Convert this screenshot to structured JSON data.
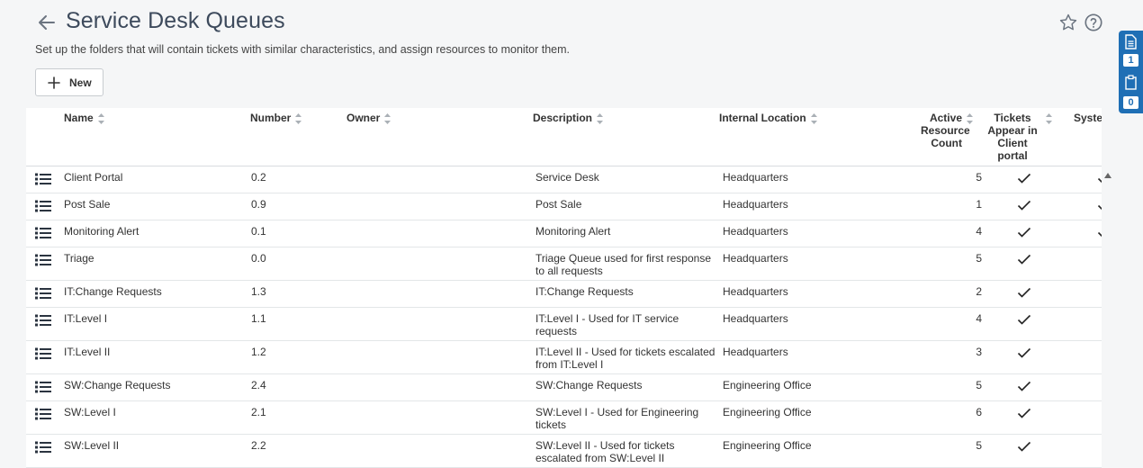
{
  "header": {
    "title": "Service Desk Queues",
    "subtitle": "Set up the folders that will contain tickets with similar characteristics, and assign resources to monitor them."
  },
  "toolbar": {
    "new_label": "New"
  },
  "side_panel": {
    "badge_top": "1",
    "badge_bottom": "0"
  },
  "table": {
    "columns": {
      "name": "Name",
      "number": "Number",
      "owner": "Owner",
      "description": "Description",
      "location": "Internal Location",
      "active_count": "Active Resource Count",
      "portal": "Tickets Appear in Client portal",
      "system": "System"
    },
    "rows": [
      {
        "name": "Client Portal",
        "number": "0.2",
        "owner": "",
        "desc1": "Service Desk",
        "desc2": "",
        "location": "Headquarters",
        "count": "5",
        "portal": true,
        "system": true
      },
      {
        "name": "Post Sale",
        "number": "0.9",
        "owner": "",
        "desc1": "Post Sale",
        "desc2": "",
        "location": "Headquarters",
        "count": "1",
        "portal": true,
        "system": true
      },
      {
        "name": "Monitoring Alert",
        "number": "0.1",
        "owner": "",
        "desc1": "Monitoring Alert",
        "desc2": "",
        "location": "Headquarters",
        "count": "4",
        "portal": true,
        "system": true
      },
      {
        "name": "Triage",
        "number": "0.0",
        "owner": "",
        "desc1": "Triage Queue used for first response",
        "desc2": "to all requests",
        "location": "Headquarters",
        "count": "5",
        "portal": true,
        "system": false
      },
      {
        "name": "IT:Change Requests",
        "number": "1.3",
        "owner": "",
        "desc1": "IT:Change Requests",
        "desc2": "",
        "location": "Headquarters",
        "count": "2",
        "portal": true,
        "system": false
      },
      {
        "name": "IT:Level I",
        "number": "1.1",
        "owner": "",
        "desc1": "IT:Level I - Used for IT service",
        "desc2": "requests",
        "location": "Headquarters",
        "count": "4",
        "portal": true,
        "system": false
      },
      {
        "name": "IT:Level II",
        "number": "1.2",
        "owner": "",
        "desc1": "IT:Level II - Used for tickets escalated",
        "desc2": "from IT:Level I",
        "location": "Headquarters",
        "count": "3",
        "portal": true,
        "system": false
      },
      {
        "name": "SW:Change Requests",
        "number": "2.4",
        "owner": "",
        "desc1": "SW:Change Requests",
        "desc2": "",
        "location": "Engineering Office",
        "count": "5",
        "portal": true,
        "system": false
      },
      {
        "name": "SW:Level I",
        "number": "2.1",
        "owner": "",
        "desc1": "SW:Level I - Used for Engineering",
        "desc2": "tickets",
        "location": "Engineering Office",
        "count": "6",
        "portal": true,
        "system": false
      },
      {
        "name": "SW:Level II",
        "number": "2.2",
        "owner": "",
        "desc1": "SW:Level II - Used for tickets",
        "desc2": "escalated from SW:Level II",
        "location": "Engineering Office",
        "count": "5",
        "portal": true,
        "system": false
      }
    ]
  }
}
